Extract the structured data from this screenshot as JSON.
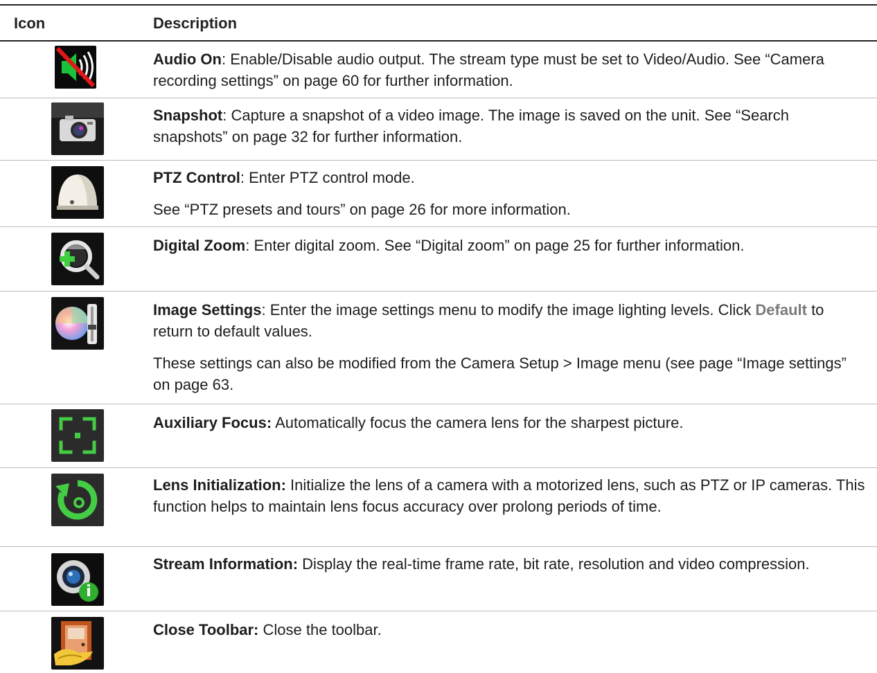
{
  "header": {
    "icon_col": "Icon",
    "desc_col": "Description"
  },
  "rows": [
    {
      "icon": "audio-on-icon",
      "title": "Audio On",
      "sep": ": ",
      "text": "Enable/Disable audio output. The stream type must be set to Video/Audio. See “Camera recording settings” on page 60 for further information."
    },
    {
      "icon": "snapshot-icon",
      "title": "Snapshot",
      "sep": ": ",
      "text": "Capture a snapshot of a video image. The image is saved on the unit. See “Search snapshots” on page 32 for further information."
    },
    {
      "icon": "ptz-dome-icon",
      "title": "PTZ Control",
      "sep": ": ",
      "text": "Enter PTZ control mode.",
      "text2": "See “PTZ presets and tours” on page 26 for more information."
    },
    {
      "icon": "digital-zoom-icon",
      "title": "Digital Zoom",
      "sep": ": ",
      "text": "Enter digital zoom. See “Digital zoom” on page 25 for further information."
    },
    {
      "icon": "image-settings-icon",
      "title": "Image Settings",
      "sep": ": ",
      "text_a": "Enter the image settings menu to modify the image lighting levels. Click ",
      "link": "Default",
      "text_b": " to return to default values.",
      "text2": "These settings can also be modified from the Camera Setup > Image menu (see page “Image settings” on page 63."
    },
    {
      "icon": "auxiliary-focus-icon",
      "title": "Auxiliary Focus:",
      "sep": " ",
      "text": "Automatically focus the camera lens for the sharpest picture."
    },
    {
      "icon": "lens-initialization-icon",
      "title": "Lens Initialization:",
      "sep": " ",
      "text": "Initialize the lens of a camera with a motorized lens, such as PTZ or IP cameras. This function helps to maintain lens focus accuracy over prolong periods of time."
    },
    {
      "icon": "stream-information-icon",
      "title": "Stream Information:",
      "sep": " ",
      "text": "Display the real-time frame rate, bit rate, resolution and video compression."
    },
    {
      "icon": "close-toolbar-icon",
      "title": "Close Toolbar:",
      "sep": " ",
      "text": "Close the toolbar."
    }
  ]
}
